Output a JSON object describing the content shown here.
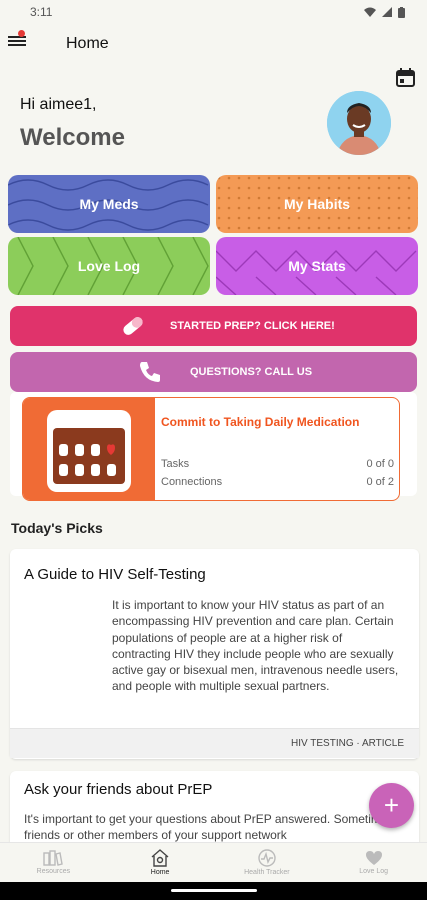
{
  "status_bar": {
    "time": "3:11"
  },
  "app_bar": {
    "title": "Home"
  },
  "greeting": {
    "hello": "Hi aimee1,",
    "welcome": "Welcome"
  },
  "tiles": [
    {
      "label": "My Meds",
      "color": "#5e6fc4"
    },
    {
      "label": "My Habits",
      "color": "#f49a55"
    },
    {
      "label": "Love Log",
      "color": "#8ccd5a"
    },
    {
      "label": "My Stats",
      "color": "#c85ee6"
    }
  ],
  "cta": {
    "prep_label": "STARTED PREP? CLICK HERE!",
    "prep_color": "#e0336b",
    "call_label": "QUESTIONS? CALL US",
    "call_color": "#c266ae"
  },
  "commitment": {
    "title": "Commit to Taking Daily Medication",
    "tasks_label": "Tasks",
    "tasks_value": "0 of 0",
    "connections_label": "Connections",
    "connections_value": "0 of 2"
  },
  "picks": {
    "title": "Today's Picks",
    "items": [
      {
        "title": "A Guide to HIV Self-Testing",
        "body": "It is important to know your HIV status as part of an encompassing HIV prevention and care plan. Certain populations of people are at a higher risk of contracting HIV they include people who are sexually active gay or bisexual men, intravenous needle users, and people with multiple sexual partners.",
        "tag": "HIV TESTING · ARTICLE"
      },
      {
        "title": "Ask your friends about PrEP",
        "body": "It's important to get your questions about PrEP answered. Sometimes friends or other members of your support network"
      }
    ]
  },
  "fab": {
    "label": "+"
  },
  "bottom_nav": [
    {
      "label": "Resources",
      "icon": "books-icon"
    },
    {
      "label": "Home",
      "icon": "home-icon"
    },
    {
      "label": "Health Tracker",
      "icon": "tracker-icon"
    },
    {
      "label": "Love Log",
      "icon": "heart-icon"
    }
  ]
}
